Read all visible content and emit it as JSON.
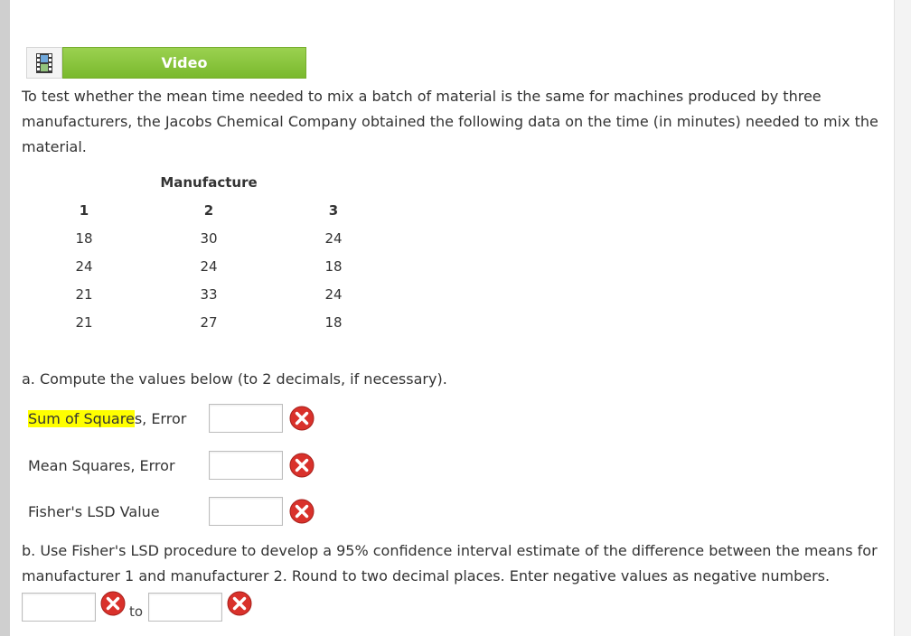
{
  "video": {
    "label": "Video",
    "icon": "film-icon"
  },
  "intro_text": "To test whether the mean time needed to mix a batch of material is the same for machines produced by three manufacturers, the Jacobs Chemical Company obtained the following data on the time (in minutes) needed to mix the material.",
  "table": {
    "group_header": "Manufacture",
    "columns": [
      "1",
      "2",
      "3"
    ],
    "rows": [
      [
        "18",
        "30",
        "24"
      ],
      [
        "24",
        "24",
        "18"
      ],
      [
        "21",
        "33",
        "24"
      ],
      [
        "21",
        "27",
        "18"
      ]
    ]
  },
  "part_a": {
    "prompt": "a. Compute the values below (to 2 decimals, if necessary).",
    "fields": [
      {
        "label_highlight": "Sum of Square",
        "label_rest": "s, Error",
        "value": "",
        "status_icon": "incorrect-x-icon"
      },
      {
        "label": "Mean Squares, Error",
        "value": "",
        "status_icon": "incorrect-x-icon"
      },
      {
        "label": "Fisher's LSD Value",
        "value": "",
        "status_icon": "incorrect-x-icon"
      }
    ]
  },
  "part_b": {
    "prompt": "b. Use Fisher's LSD procedure to develop a 95% confidence interval estimate of the difference between the means for manufacturer 1 and manufacturer 2. Round to two decimal places. Enter negative values as negative numbers.",
    "lower_value": "",
    "upper_value": "",
    "to_label": "to"
  },
  "colors": {
    "video_green": "#8cc63f",
    "highlight": "#ffff00",
    "error_red": "#d9312b"
  }
}
